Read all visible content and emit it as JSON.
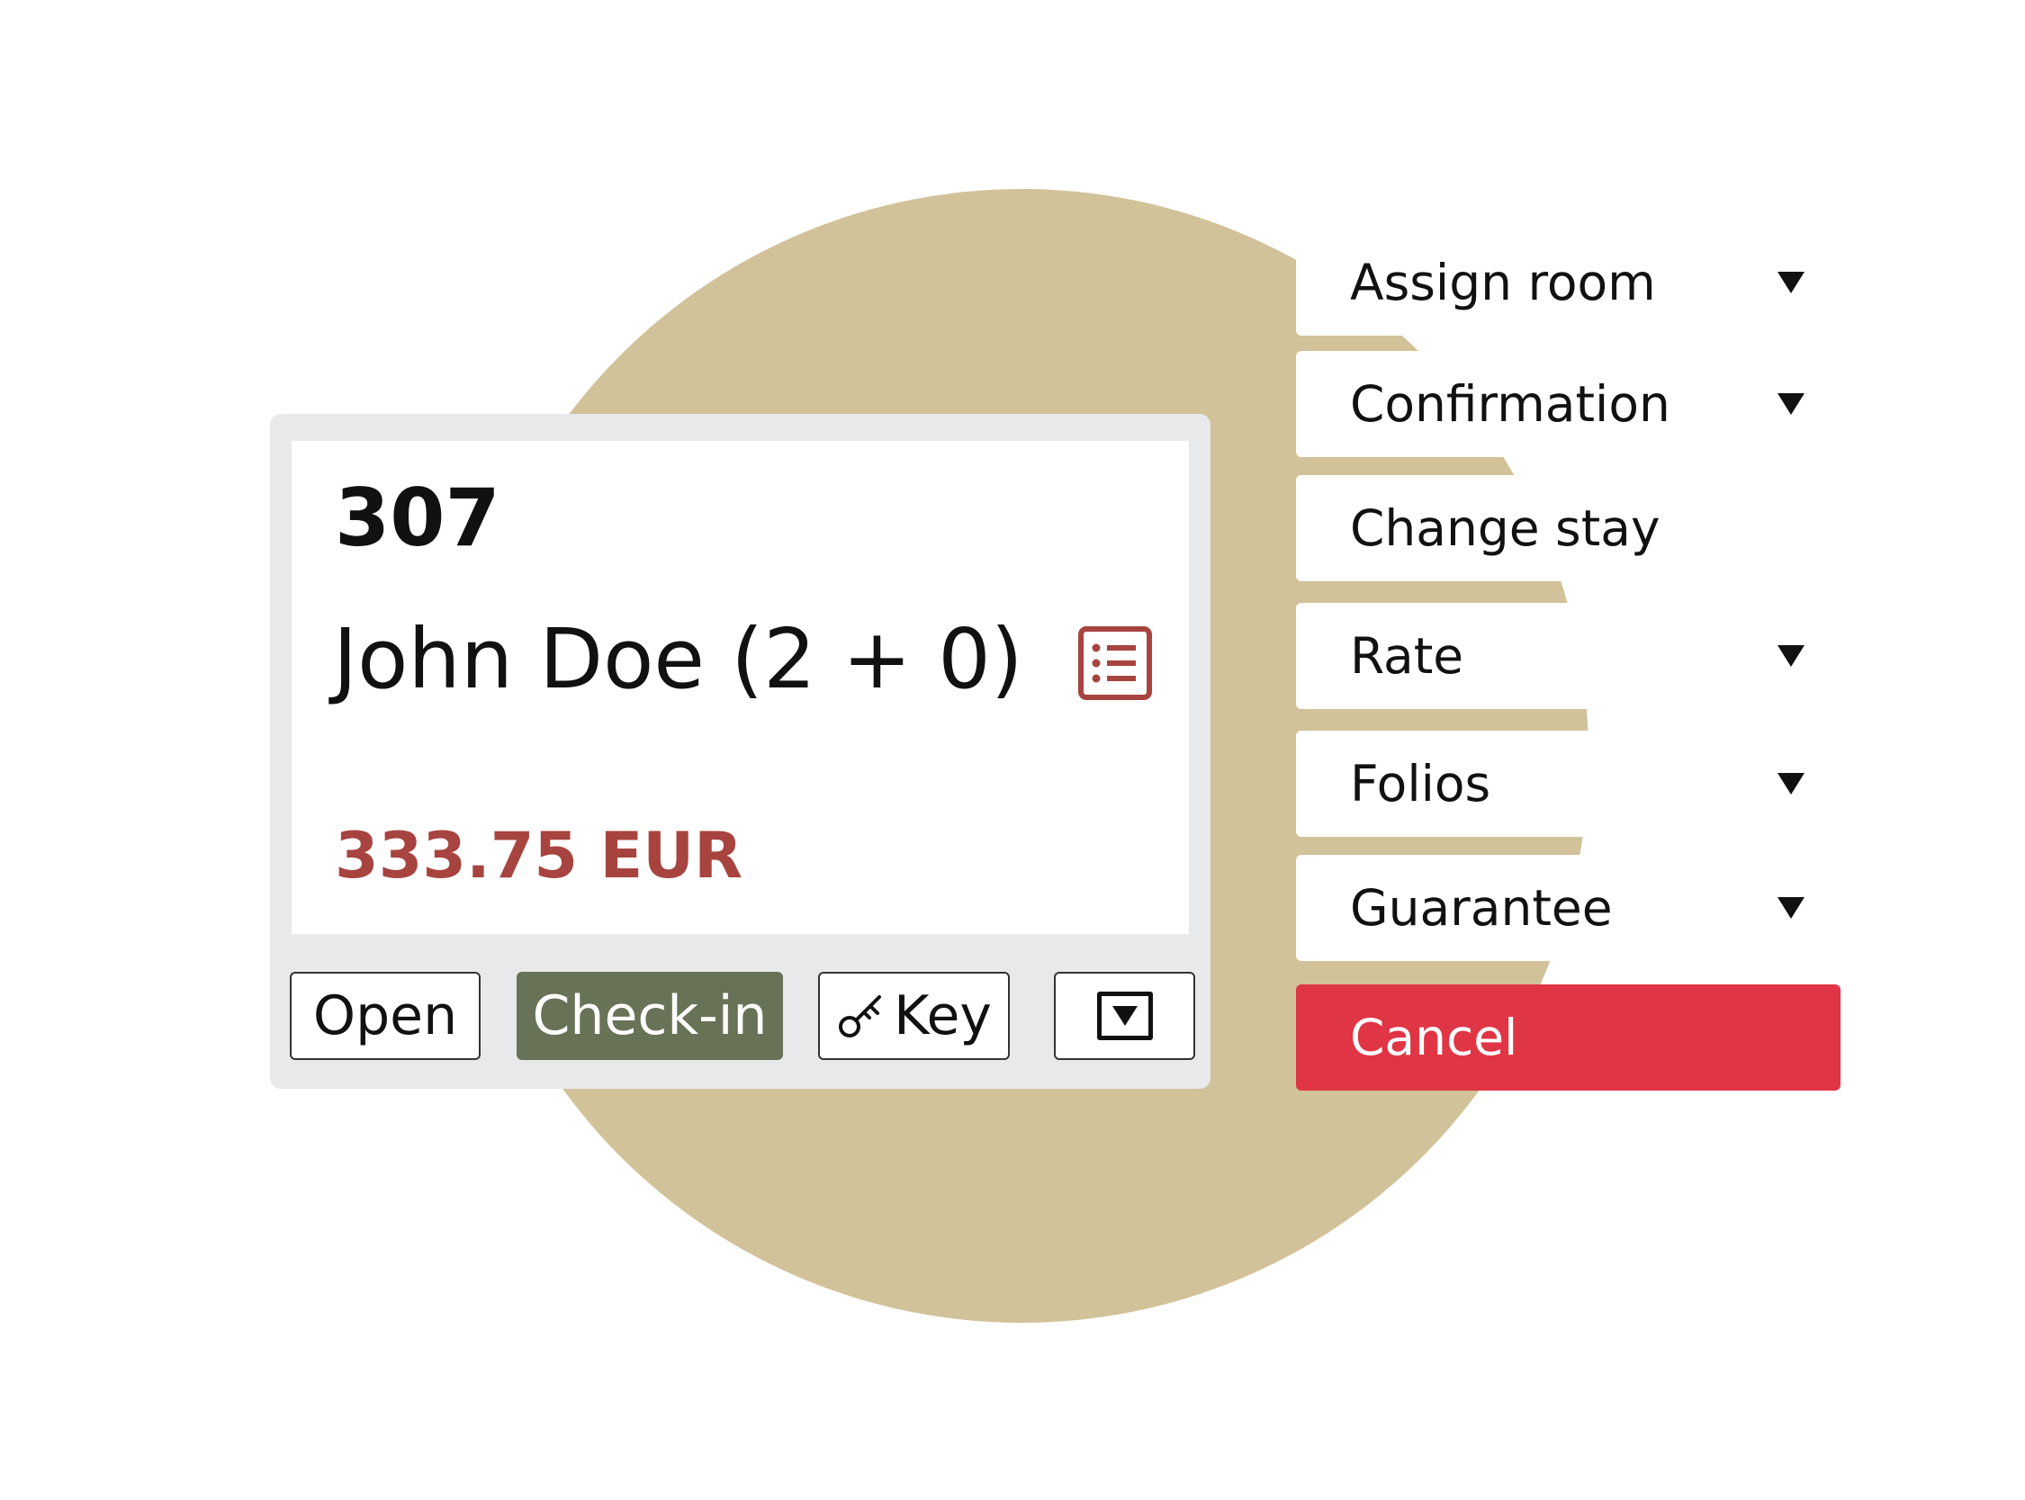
{
  "reservation": {
    "room_number": "307",
    "guest": "John Doe (2 + 0)",
    "balance": "333.75 EUR",
    "icons": {
      "details": "list-icon",
      "key": "key-icon",
      "more": "dropdown-icon"
    }
  },
  "actions": {
    "open": "Open",
    "checkin": "Check-in",
    "key": "Key"
  },
  "menu": {
    "items": [
      {
        "label": "Assign room",
        "has_submenu": true
      },
      {
        "label": "Confirmation",
        "has_submenu": true
      },
      {
        "label": "Change stay",
        "has_submenu": false
      },
      {
        "label": "Rate",
        "has_submenu": true
      },
      {
        "label": "Folios",
        "has_submenu": true
      },
      {
        "label": "Guarantee",
        "has_submenu": true
      },
      {
        "label": "Cancel",
        "has_submenu": false
      }
    ]
  },
  "colors": {
    "circle": "#d2c29a",
    "price": "#a8443f",
    "checkin": "#687256",
    "cancel": "#e03545",
    "card_frame": "#e8e9eb"
  }
}
